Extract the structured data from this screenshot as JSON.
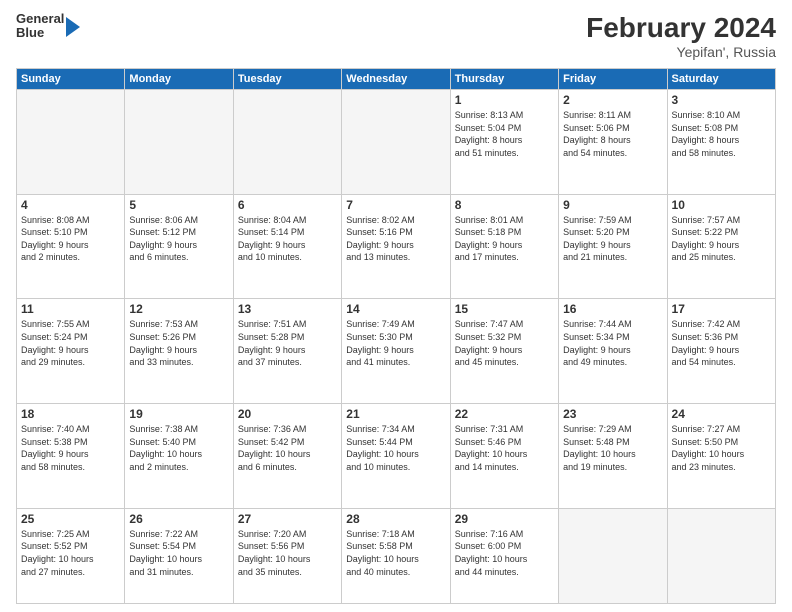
{
  "logo": {
    "line1": "General",
    "line2": "Blue"
  },
  "title": "February 2024",
  "subtitle": "Yepifan', Russia",
  "weekdays": [
    "Sunday",
    "Monday",
    "Tuesday",
    "Wednesday",
    "Thursday",
    "Friday",
    "Saturday"
  ],
  "weeks": [
    [
      {
        "day": "",
        "info": ""
      },
      {
        "day": "",
        "info": ""
      },
      {
        "day": "",
        "info": ""
      },
      {
        "day": "",
        "info": ""
      },
      {
        "day": "1",
        "info": "Sunrise: 8:13 AM\nSunset: 5:04 PM\nDaylight: 8 hours\nand 51 minutes."
      },
      {
        "day": "2",
        "info": "Sunrise: 8:11 AM\nSunset: 5:06 PM\nDaylight: 8 hours\nand 54 minutes."
      },
      {
        "day": "3",
        "info": "Sunrise: 8:10 AM\nSunset: 5:08 PM\nDaylight: 8 hours\nand 58 minutes."
      }
    ],
    [
      {
        "day": "4",
        "info": "Sunrise: 8:08 AM\nSunset: 5:10 PM\nDaylight: 9 hours\nand 2 minutes."
      },
      {
        "day": "5",
        "info": "Sunrise: 8:06 AM\nSunset: 5:12 PM\nDaylight: 9 hours\nand 6 minutes."
      },
      {
        "day": "6",
        "info": "Sunrise: 8:04 AM\nSunset: 5:14 PM\nDaylight: 9 hours\nand 10 minutes."
      },
      {
        "day": "7",
        "info": "Sunrise: 8:02 AM\nSunset: 5:16 PM\nDaylight: 9 hours\nand 13 minutes."
      },
      {
        "day": "8",
        "info": "Sunrise: 8:01 AM\nSunset: 5:18 PM\nDaylight: 9 hours\nand 17 minutes."
      },
      {
        "day": "9",
        "info": "Sunrise: 7:59 AM\nSunset: 5:20 PM\nDaylight: 9 hours\nand 21 minutes."
      },
      {
        "day": "10",
        "info": "Sunrise: 7:57 AM\nSunset: 5:22 PM\nDaylight: 9 hours\nand 25 minutes."
      }
    ],
    [
      {
        "day": "11",
        "info": "Sunrise: 7:55 AM\nSunset: 5:24 PM\nDaylight: 9 hours\nand 29 minutes."
      },
      {
        "day": "12",
        "info": "Sunrise: 7:53 AM\nSunset: 5:26 PM\nDaylight: 9 hours\nand 33 minutes."
      },
      {
        "day": "13",
        "info": "Sunrise: 7:51 AM\nSunset: 5:28 PM\nDaylight: 9 hours\nand 37 minutes."
      },
      {
        "day": "14",
        "info": "Sunrise: 7:49 AM\nSunset: 5:30 PM\nDaylight: 9 hours\nand 41 minutes."
      },
      {
        "day": "15",
        "info": "Sunrise: 7:47 AM\nSunset: 5:32 PM\nDaylight: 9 hours\nand 45 minutes."
      },
      {
        "day": "16",
        "info": "Sunrise: 7:44 AM\nSunset: 5:34 PM\nDaylight: 9 hours\nand 49 minutes."
      },
      {
        "day": "17",
        "info": "Sunrise: 7:42 AM\nSunset: 5:36 PM\nDaylight: 9 hours\nand 54 minutes."
      }
    ],
    [
      {
        "day": "18",
        "info": "Sunrise: 7:40 AM\nSunset: 5:38 PM\nDaylight: 9 hours\nand 58 minutes."
      },
      {
        "day": "19",
        "info": "Sunrise: 7:38 AM\nSunset: 5:40 PM\nDaylight: 10 hours\nand 2 minutes."
      },
      {
        "day": "20",
        "info": "Sunrise: 7:36 AM\nSunset: 5:42 PM\nDaylight: 10 hours\nand 6 minutes."
      },
      {
        "day": "21",
        "info": "Sunrise: 7:34 AM\nSunset: 5:44 PM\nDaylight: 10 hours\nand 10 minutes."
      },
      {
        "day": "22",
        "info": "Sunrise: 7:31 AM\nSunset: 5:46 PM\nDaylight: 10 hours\nand 14 minutes."
      },
      {
        "day": "23",
        "info": "Sunrise: 7:29 AM\nSunset: 5:48 PM\nDaylight: 10 hours\nand 19 minutes."
      },
      {
        "day": "24",
        "info": "Sunrise: 7:27 AM\nSunset: 5:50 PM\nDaylight: 10 hours\nand 23 minutes."
      }
    ],
    [
      {
        "day": "25",
        "info": "Sunrise: 7:25 AM\nSunset: 5:52 PM\nDaylight: 10 hours\nand 27 minutes."
      },
      {
        "day": "26",
        "info": "Sunrise: 7:22 AM\nSunset: 5:54 PM\nDaylight: 10 hours\nand 31 minutes."
      },
      {
        "day": "27",
        "info": "Sunrise: 7:20 AM\nSunset: 5:56 PM\nDaylight: 10 hours\nand 35 minutes."
      },
      {
        "day": "28",
        "info": "Sunrise: 7:18 AM\nSunset: 5:58 PM\nDaylight: 10 hours\nand 40 minutes."
      },
      {
        "day": "29",
        "info": "Sunrise: 7:16 AM\nSunset: 6:00 PM\nDaylight: 10 hours\nand 44 minutes."
      },
      {
        "day": "",
        "info": ""
      },
      {
        "day": "",
        "info": ""
      }
    ]
  ]
}
